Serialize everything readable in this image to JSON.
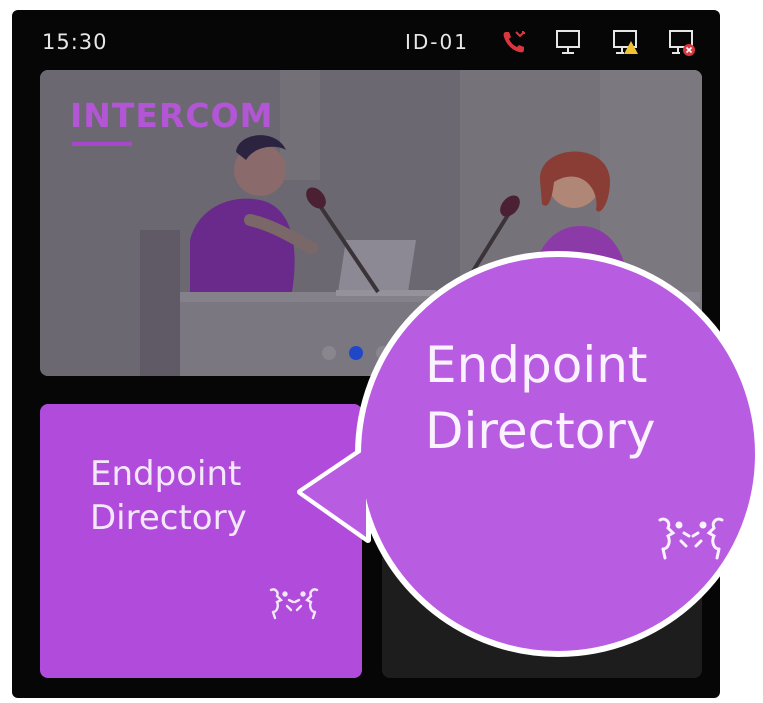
{
  "status_bar": {
    "time": "15:30",
    "device_id": "ID-01",
    "icons": [
      "missed-call-icon",
      "monitor-icon",
      "monitor-warning-icon",
      "monitor-error-icon"
    ],
    "missed_call_color": "#d9363e"
  },
  "banner": {
    "title": "INTERCOM",
    "carousel": {
      "count": 3,
      "active_index": 1
    },
    "active_dot_color": "#1f47c8"
  },
  "tiles": [
    {
      "label_line1": "Endpoint",
      "label_line2": "Directory",
      "icon": "face-to-face-icon",
      "color": "#b04bdb"
    }
  ],
  "callout": {
    "label_line1": "Endpoint",
    "label_line2": "Directory",
    "icon": "face-to-face-icon",
    "color": "#b85ce2"
  }
}
